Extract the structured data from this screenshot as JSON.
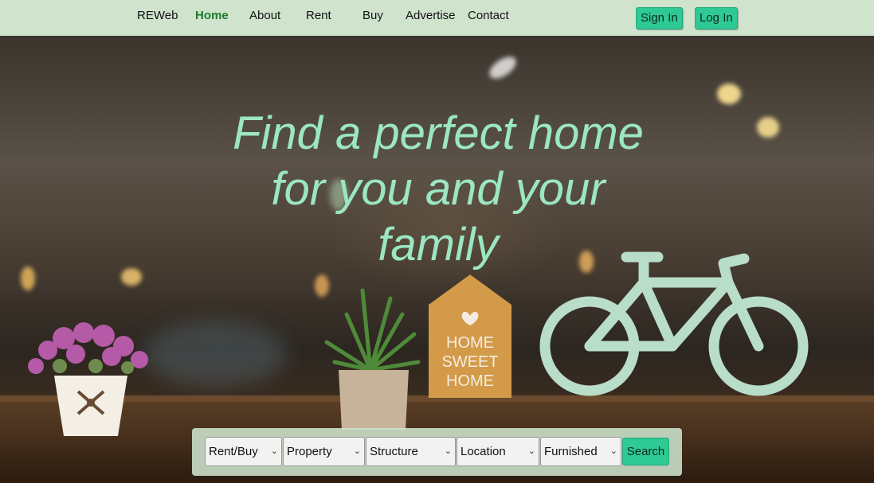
{
  "nav": {
    "brand": "REWeb",
    "links": [
      "Home",
      "About",
      "Rent",
      "Buy",
      "Advertise",
      "Contact"
    ],
    "active": "Home",
    "sign_in": "Sign In",
    "log_in": "Log In"
  },
  "hero": {
    "line1": "Find a perfect home",
    "line2": "for you and your",
    "line3": "family",
    "sign_text": [
      "HOME",
      "SWEET",
      "HOME"
    ]
  },
  "search": {
    "rent_buy": "Rent/Buy",
    "property": "Property",
    "structure": "Structure",
    "location": "Location",
    "furnished": "Furnished",
    "button": "Search"
  },
  "colors": {
    "nav_bg": "#cfe3cd",
    "accent": "#2ec995",
    "active_link": "#1e7a2c",
    "hero_text": "#9be6c3"
  }
}
